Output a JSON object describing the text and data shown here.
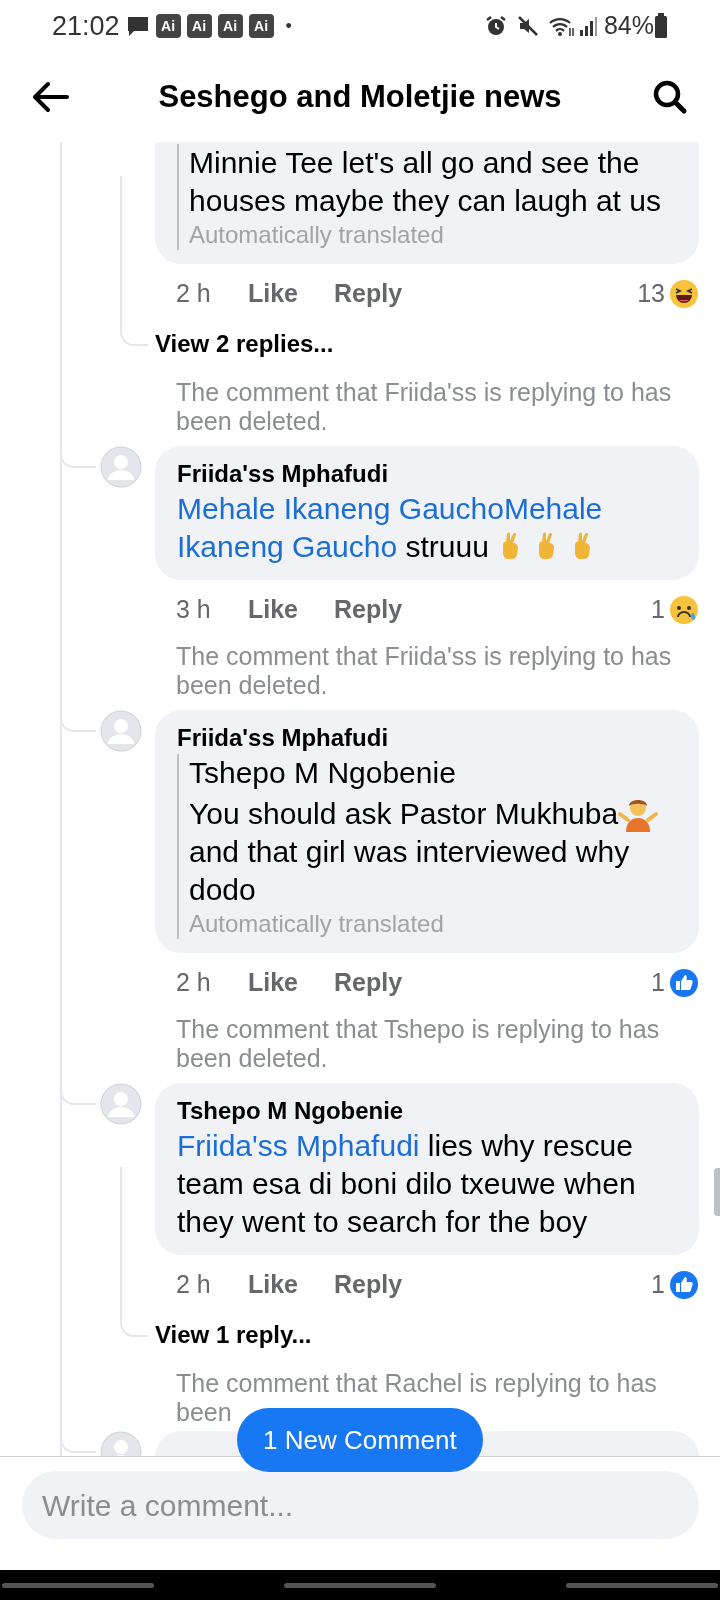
{
  "status_bar": {
    "time": "21:02",
    "badges": [
      "Ai",
      "Ai",
      "Ai",
      "Ai"
    ],
    "dot": "•",
    "battery": "84%"
  },
  "header": {
    "title": "Seshego and Moletjie news"
  },
  "thread": [
    {
      "kind": "comment",
      "body": [
        {
          "kind": "text",
          "text": "Minnie Tee let's all go and see the houses maybe they can laugh at us"
        }
      ],
      "translated": "Automatically translated",
      "time": "2 h",
      "like": "Like",
      "reply": "Reply",
      "reaction": {
        "count": "13",
        "kind": "haha"
      },
      "replies_link": "View 2 replies..."
    },
    {
      "kind": "note",
      "text": "The comment that Friida'ss is replying to has been deleted."
    },
    {
      "kind": "comment",
      "author": "Friida'ss Mphafudi",
      "body": [
        {
          "kind": "mention",
          "text": "Mehale Ikaneng GauchoMehale"
        },
        {
          "kind": "break"
        },
        {
          "kind": "mention",
          "text": "Ikaneng Gaucho"
        },
        {
          "kind": "text",
          "text": " struuu "
        },
        {
          "kind": "fingers"
        },
        {
          "kind": "fingers"
        },
        {
          "kind": "fingers"
        }
      ],
      "time": "3 h",
      "like": "Like",
      "reply": "Reply",
      "reaction": {
        "count": "1",
        "kind": "sad"
      }
    },
    {
      "kind": "note",
      "text": "The comment that Friida'ss is replying to has been deleted."
    },
    {
      "kind": "comment",
      "author": "Friida'ss Mphafudi",
      "body": [
        {
          "kind": "text",
          "text": "Tshepo M Ngobenie\nYou should ask Pastor Mukhuba"
        },
        {
          "kind": "shrug"
        },
        {
          "kind": "text",
          "text": "\nand that girl was interviewed why dodo"
        }
      ],
      "translated": "Automatically translated",
      "time": "2 h",
      "like": "Like",
      "reply": "Reply",
      "reaction": {
        "count": "1",
        "kind": "like"
      }
    },
    {
      "kind": "note",
      "text": "The comment that Tshepo is replying to has been deleted."
    },
    {
      "kind": "comment",
      "author": "Tshepo M Ngobenie",
      "body": [
        {
          "kind": "mention",
          "text": "Friida'ss Mphafudi"
        },
        {
          "kind": "text",
          "text": " lies why rescue team esa di boni dilo txeuwe when they went to search for the boy"
        }
      ],
      "time": "2 h",
      "like": "Like",
      "reply": "Reply",
      "reaction": {
        "count": "1",
        "kind": "like"
      },
      "replies_link": "View 1 reply..."
    },
    {
      "kind": "note",
      "text": "The comment that Rachel is replying to has been"
    },
    {
      "kind": "comment-stub"
    }
  ],
  "new_comment_button": "1 New Comment",
  "composer": {
    "placeholder": "Write a comment..."
  }
}
